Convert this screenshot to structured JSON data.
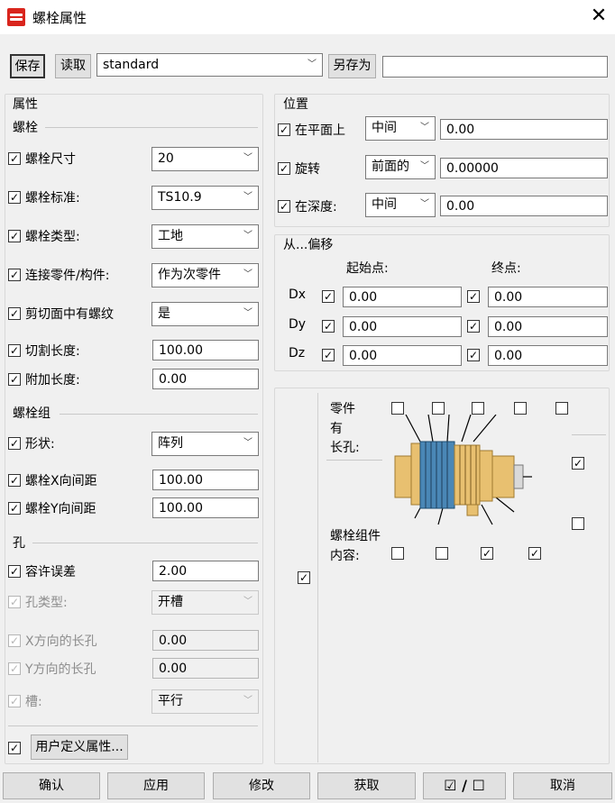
{
  "window": {
    "title": "螺栓属性",
    "close_glyph": "✕"
  },
  "toolbar": {
    "save_label": "保存",
    "load_label": "读取",
    "preset_value": "standard",
    "save_as_label": "另存为",
    "save_as_value": ""
  },
  "left": {
    "attributes_heading": "属性",
    "bolt_heading": "螺栓",
    "rows": [
      {
        "label": "螺栓尺寸",
        "value": "20",
        "checked": true
      },
      {
        "label": "螺栓标准:",
        "value": "TS10.9",
        "checked": true
      },
      {
        "label": "螺栓类型:",
        "value": "工地",
        "checked": true
      },
      {
        "label": "连接零件/构件:",
        "value": "作为次零件",
        "checked": true
      },
      {
        "label": "剪切面中有螺纹",
        "value": "是",
        "checked": true
      },
      {
        "label": "切割长度:",
        "value": "100.00",
        "checked": true
      },
      {
        "label": "附加长度:",
        "value": "0.00",
        "checked": true
      }
    ],
    "group_heading": "螺栓组",
    "group_rows": [
      {
        "label": "形状:",
        "value": "阵列",
        "checked": true
      },
      {
        "label": "螺栓X向间距",
        "value": "100.00",
        "checked": true
      },
      {
        "label": "螺栓Y向间距",
        "value": "100.00",
        "checked": true
      }
    ],
    "hole_heading": "孔",
    "hole_rows": [
      {
        "label": "容许误差",
        "value": "2.00",
        "checked": true
      },
      {
        "label": "孔类型:",
        "value": "开槽",
        "checked": true
      },
      {
        "label": "X方向的长孔",
        "value": "0.00",
        "checked": true
      },
      {
        "label": "Y方向的长孔",
        "value": "0.00",
        "checked": true
      },
      {
        "label": "槽:",
        "value": "平行",
        "checked": true
      }
    ],
    "udef_label": "用户定义属性..."
  },
  "position": {
    "heading": "位置",
    "rows": [
      {
        "label": "在平面上",
        "select": "中间",
        "value": "0.00"
      },
      {
        "label": "旋转",
        "select": "前面的",
        "value": "0.00000"
      },
      {
        "label": "在深度:",
        "select": "中间",
        "value": "0.00"
      }
    ]
  },
  "offset": {
    "heading": "从...偏移",
    "start_label": "起始点:",
    "end_label": "终点:",
    "rows": [
      {
        "axis": "Dx",
        "start": "0.00",
        "end": "0.00"
      },
      {
        "axis": "Dy",
        "start": "0.00",
        "end": "0.00"
      },
      {
        "axis": "Dz",
        "start": "0.00",
        "end": "0.00"
      }
    ]
  },
  "assembly": {
    "slotted_label_1": "零件",
    "slotted_label_2": "有",
    "slotted_label_3": "长孔:",
    "content_label_1": "螺栓组件",
    "content_label_2": "内容:",
    "slotted_checks": [
      false,
      false,
      false,
      false,
      false
    ],
    "content_checks": [
      false,
      false,
      true,
      true
    ],
    "right_checks": [
      true,
      false
    ],
    "left_check": true
  },
  "footer": {
    "ok_label": "确认",
    "apply_label": "应用",
    "modify_label": "修改",
    "get_label": "获取",
    "toggle_label": "☑ / ☐",
    "cancel_label": "取消"
  },
  "check_glyph": "✓"
}
